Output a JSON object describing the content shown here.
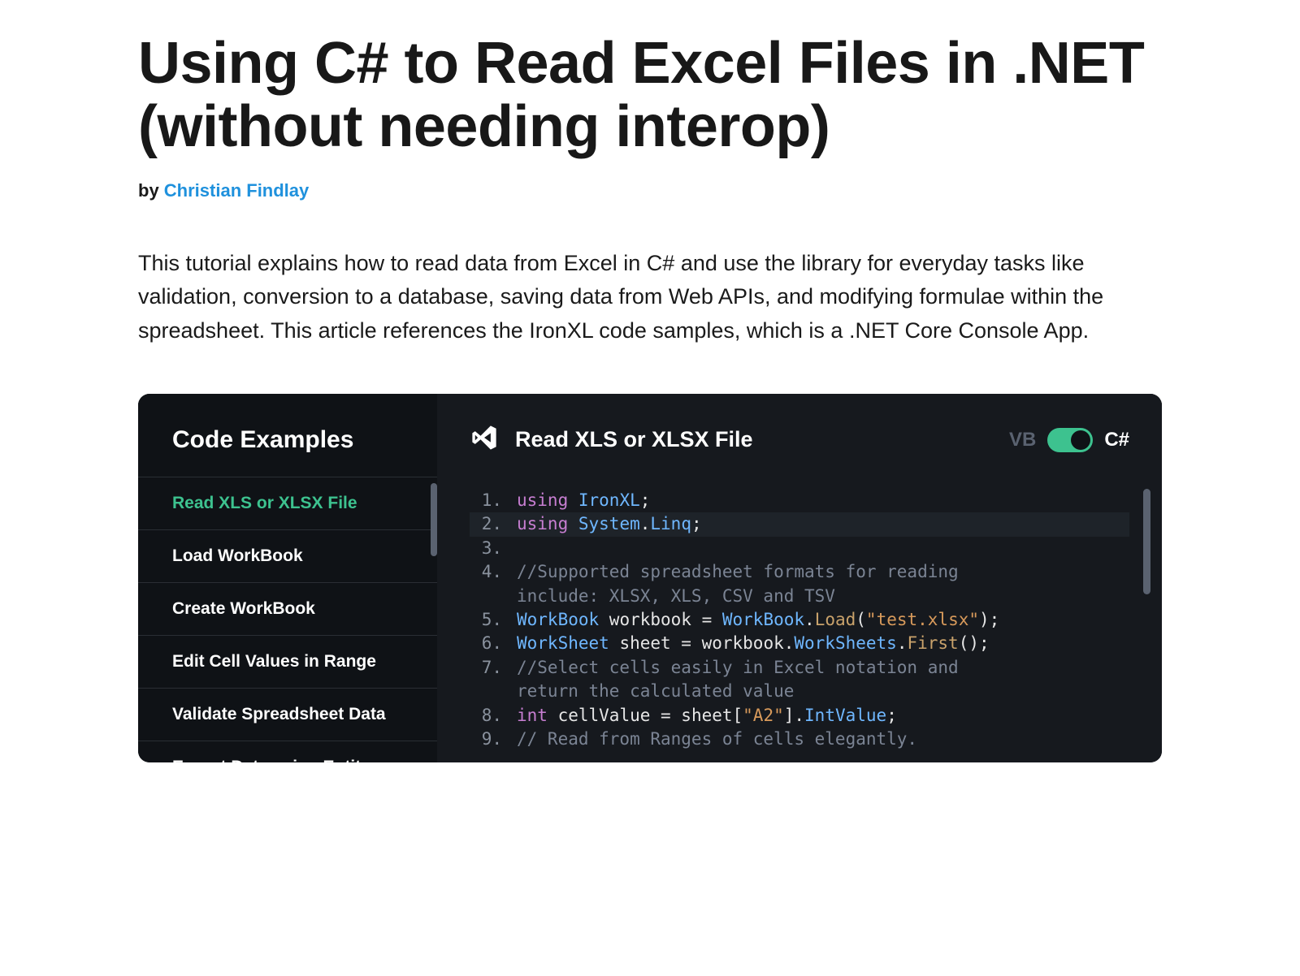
{
  "article": {
    "title": "Using C# to Read Excel Files in .NET (without needing interop)",
    "by_label": "by ",
    "author": "Christian Findlay",
    "intro": "This tutorial explains how to read data from Excel in C# and use the library for everyday tasks like validation, conversion to a database, saving data from Web APIs, and modifying formulae within the spreadsheet. This article references the IronXL code samples, which is a .NET Core Console App."
  },
  "sidebar": {
    "title": "Code Examples",
    "items": [
      "Read XLS or XLSX File",
      "Load WorkBook",
      "Create WorkBook",
      "Edit Cell Values in Range",
      "Validate Spreadsheet Data",
      "Export Data using Entity"
    ],
    "active_index": 0
  },
  "main": {
    "title": "Read XLS or XLSX File",
    "lang_vb": "VB",
    "lang_cs": "C#"
  },
  "code": {
    "lines": [
      {
        "n": 1,
        "hl": false,
        "tokens": [
          {
            "t": "using",
            "c": "kw"
          },
          {
            "t": " ",
            "c": "plain"
          },
          {
            "t": "IronXL",
            "c": "type"
          },
          {
            "t": ";",
            "c": "plain"
          }
        ]
      },
      {
        "n": 2,
        "hl": true,
        "tokens": [
          {
            "t": "using",
            "c": "kw"
          },
          {
            "t": " ",
            "c": "plain"
          },
          {
            "t": "System",
            "c": "type"
          },
          {
            "t": ".",
            "c": "plain"
          },
          {
            "t": "Linq",
            "c": "type"
          },
          {
            "t": ";",
            "c": "plain"
          }
        ]
      },
      {
        "n": 3,
        "hl": false,
        "tokens": []
      },
      {
        "n": 4,
        "hl": false,
        "tokens": [
          {
            "t": "//Supported spreadsheet formats for reading ",
            "c": "cm"
          }
        ]
      },
      {
        "n": -1,
        "hl": false,
        "tokens": [
          {
            "t": "include: XLSX, XLS, CSV and TSV",
            "c": "cm"
          }
        ]
      },
      {
        "n": 5,
        "hl": false,
        "tokens": [
          {
            "t": "WorkBook",
            "c": "type"
          },
          {
            "t": " workbook = ",
            "c": "plain"
          },
          {
            "t": "WorkBook",
            "c": "type"
          },
          {
            "t": ".",
            "c": "plain"
          },
          {
            "t": "Load",
            "c": "method"
          },
          {
            "t": "(",
            "c": "plain"
          },
          {
            "t": "\"test.xlsx\"",
            "c": "str"
          },
          {
            "t": ");",
            "c": "plain"
          }
        ]
      },
      {
        "n": 6,
        "hl": false,
        "tokens": [
          {
            "t": "WorkSheet",
            "c": "type"
          },
          {
            "t": " sheet = workbook.",
            "c": "plain"
          },
          {
            "t": "WorkSheets",
            "c": "type"
          },
          {
            "t": ".",
            "c": "plain"
          },
          {
            "t": "First",
            "c": "method"
          },
          {
            "t": "();",
            "c": "plain"
          }
        ]
      },
      {
        "n": 7,
        "hl": false,
        "tokens": [
          {
            "t": "//Select cells easily in Excel notation and ",
            "c": "cm"
          }
        ]
      },
      {
        "n": -1,
        "hl": false,
        "tokens": [
          {
            "t": "return the calculated value",
            "c": "cm"
          }
        ]
      },
      {
        "n": 8,
        "hl": false,
        "tokens": [
          {
            "t": "int",
            "c": "kw"
          },
          {
            "t": " cellValue = sheet[",
            "c": "plain"
          },
          {
            "t": "\"A2\"",
            "c": "str"
          },
          {
            "t": "].",
            "c": "plain"
          },
          {
            "t": "IntValue",
            "c": "type"
          },
          {
            "t": ";",
            "c": "plain"
          }
        ]
      },
      {
        "n": 9,
        "hl": false,
        "tokens": [
          {
            "t": "// Read from Ranges of cells elegantly.",
            "c": "cm"
          }
        ]
      }
    ]
  }
}
